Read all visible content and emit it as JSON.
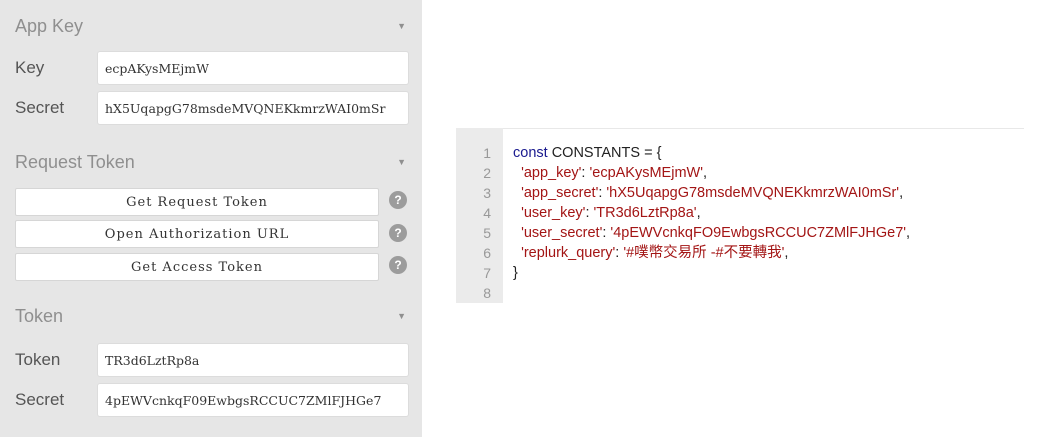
{
  "sections": {
    "app_key": {
      "title": "App Key",
      "key_label": "Key",
      "key_value": "ecpAKysMEjmW",
      "secret_label": "Secret",
      "secret_value": "hX5UqapgG78msdeMVQNEKkmrzWAI0mSr"
    },
    "request_token": {
      "title": "Request Token",
      "buttons": [
        {
          "label": "Get Request Token",
          "help": "?"
        },
        {
          "label": "Open Authorization URL",
          "help": "?"
        },
        {
          "label": "Get Access Token",
          "help": "?"
        }
      ]
    },
    "token": {
      "title": "Token",
      "token_label": "Token",
      "token_value": "TR3d6LztRp8a",
      "secret_label": "Secret",
      "secret_value": "4pEWVcnkqF09EwbgsRCCUC7ZMlFJHGe7"
    }
  },
  "caret_symbol": "▼",
  "code": {
    "line_numbers": [
      "1",
      "2",
      "3",
      "4",
      "5",
      "6",
      "7",
      "8"
    ],
    "keyword_const": "const",
    "constants_name": " CONSTANTS = {",
    "entries": [
      {
        "key": "'app_key'",
        "value": "'ecpAKysMEjmW'",
        "sep": ","
      },
      {
        "key": "'app_secret'",
        "value": "'hX5UqapgG78msdeMVQNEKkmrzWAI0mSr'",
        "sep": ","
      },
      {
        "key": "'user_key'",
        "value": "'TR3d6LztRp8a'",
        "sep": ","
      },
      {
        "key": "'user_secret'",
        "value": "'4pEWVcnkqFO9EwbgsRCCUC7ZMlFJHGe7'",
        "sep": ","
      },
      {
        "key": "'replurk_query'",
        "value": "'#噗幣交易所 -#不要轉我'",
        "sep": ","
      }
    ],
    "closing": "}",
    "last_line": ""
  },
  "colors": {
    "panel_bg": "#e6e6e6",
    "gutter_bg": "#ebebeb",
    "keyword": "#1a1a8f",
    "string": "#a31515"
  }
}
